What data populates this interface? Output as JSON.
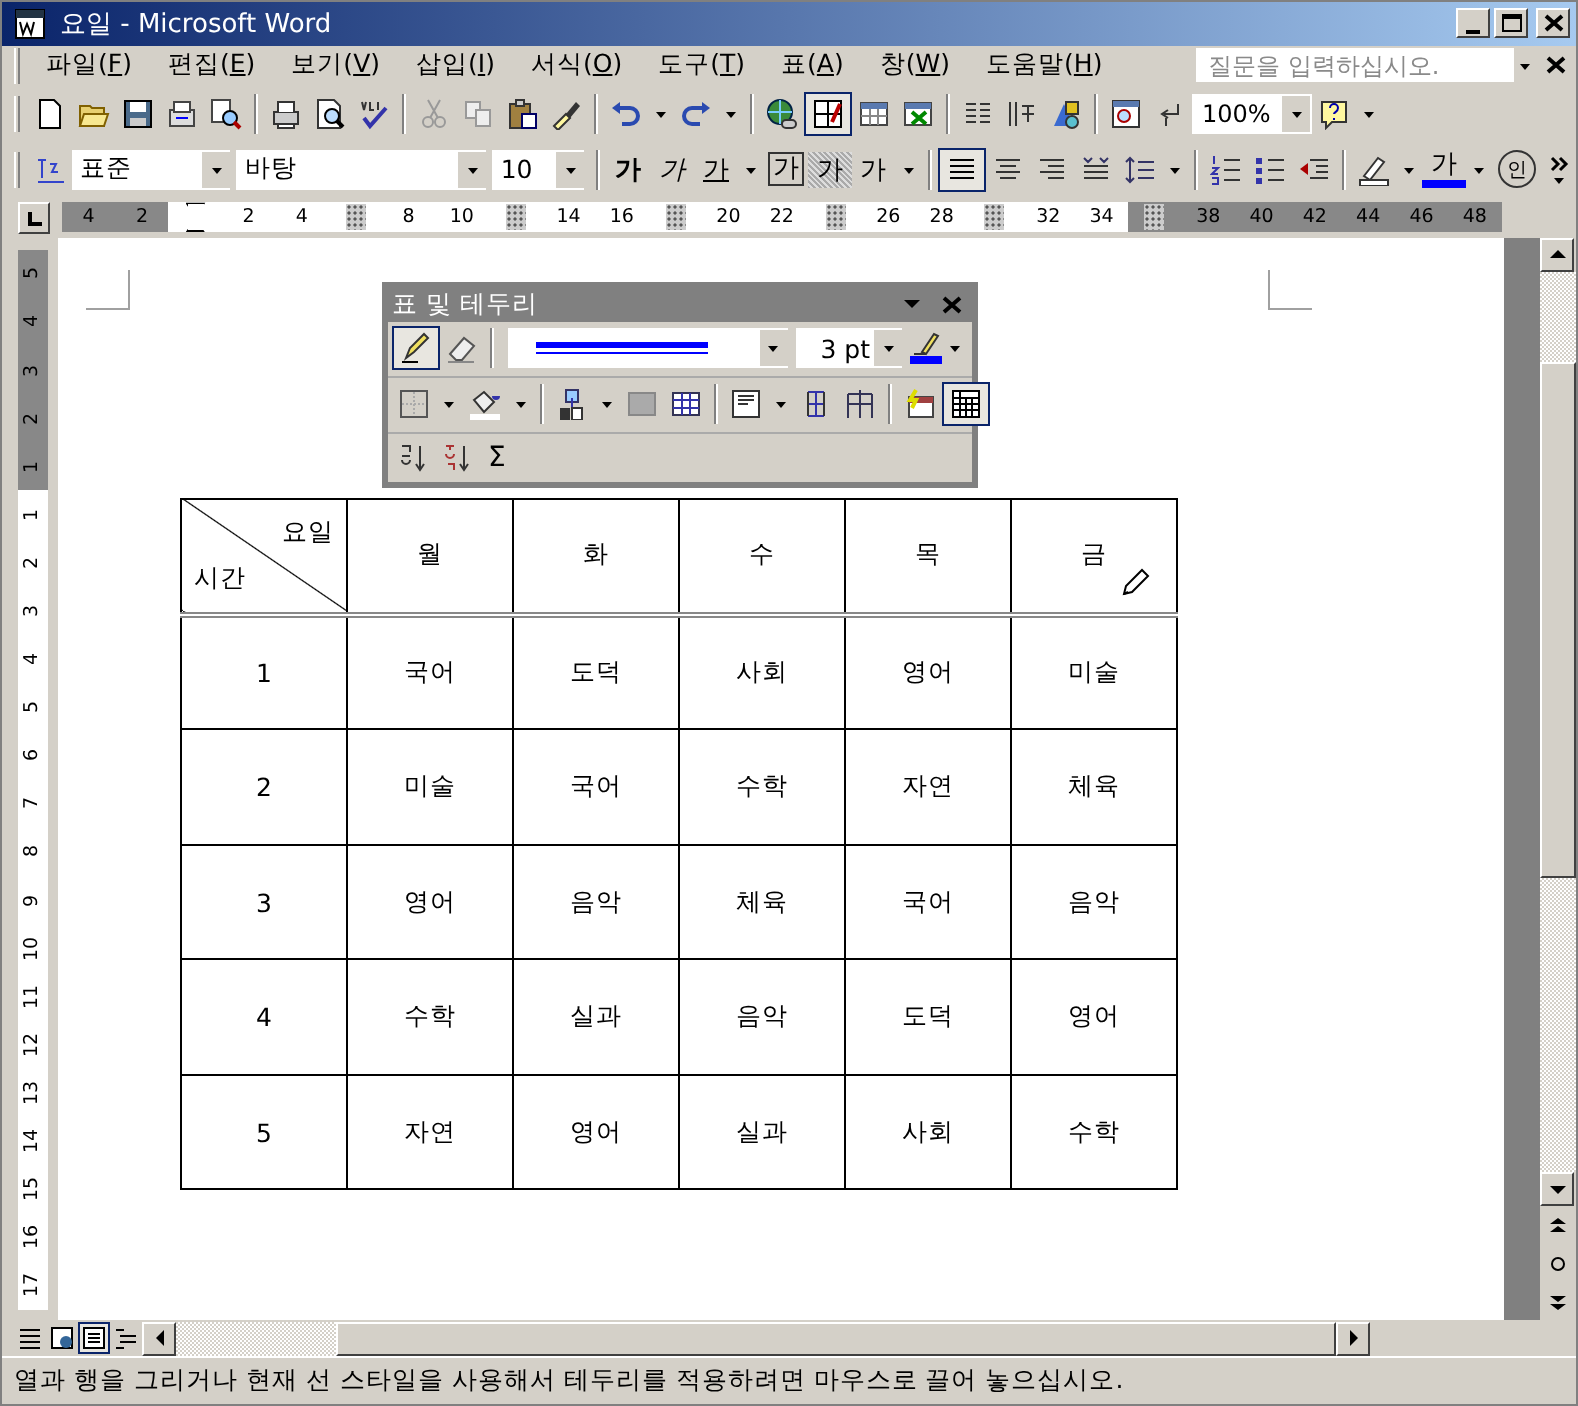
{
  "window": {
    "title": "요일 - Microsoft Word"
  },
  "menu_bar": {
    "items": [
      "파일(F)",
      "편집(E)",
      "보기(V)",
      "삽입(I)",
      "서식(O)",
      "도구(T)",
      "표(A)",
      "창(W)",
      "도움말(H)"
    ],
    "help_box": {
      "placeholder": "질문을 입력하십시오."
    }
  },
  "standard_toolbar": {
    "tables_and_borders_pressed": true,
    "zoom": "100%"
  },
  "formatting_toolbar": {
    "style": "표준",
    "font": "바탕",
    "size": "10",
    "glyph_buttons": [
      {
        "glyph": "가",
        "kind": "bold"
      },
      {
        "glyph": "가",
        "kind": "italic"
      },
      {
        "glyph": "가",
        "kind": "underline"
      },
      {
        "glyph": "가",
        "kind": "boxed"
      },
      {
        "glyph": "가",
        "kind": "shaded"
      },
      {
        "glyph": "가",
        "kind": "spacing"
      }
    ],
    "align_left_pressed": true,
    "font_color_glyph": "가",
    "enclosed_glyph": "인"
  },
  "ruler": [
    {
      "kind": "number",
      "label": "4",
      "shaded": true
    },
    {
      "kind": "number",
      "label": "2",
      "shaded": true
    },
    {
      "kind": "indent",
      "shaded": false
    },
    {
      "kind": "number",
      "label": "2",
      "shaded": false
    },
    {
      "kind": "number",
      "label": "4",
      "shaded": false
    },
    {
      "kind": "marker",
      "shaded": false
    },
    {
      "kind": "number",
      "label": "8",
      "shaded": false
    },
    {
      "kind": "number",
      "label": "10",
      "shaded": false
    },
    {
      "kind": "marker",
      "shaded": false
    },
    {
      "kind": "number",
      "label": "14",
      "shaded": false
    },
    {
      "kind": "number",
      "label": "16",
      "shaded": false
    },
    {
      "kind": "marker",
      "shaded": false
    },
    {
      "kind": "number",
      "label": "20",
      "shaded": false
    },
    {
      "kind": "number",
      "label": "22",
      "shaded": false
    },
    {
      "kind": "marker",
      "shaded": false
    },
    {
      "kind": "number",
      "label": "26",
      "shaded": false
    },
    {
      "kind": "number",
      "label": "28",
      "shaded": false
    },
    {
      "kind": "marker",
      "shaded": false
    },
    {
      "kind": "number",
      "label": "32",
      "shaded": false
    },
    {
      "kind": "number",
      "label": "34",
      "shaded": false
    },
    {
      "kind": "marker",
      "shaded": true
    },
    {
      "kind": "number",
      "label": "38",
      "shaded": true
    },
    {
      "kind": "number",
      "label": "40",
      "shaded": true
    },
    {
      "kind": "number",
      "label": "42",
      "shaded": true
    },
    {
      "kind": "number",
      "label": "44",
      "shaded": true
    },
    {
      "kind": "number",
      "label": "46",
      "shaded": true
    },
    {
      "kind": "number",
      "label": "48",
      "shaded": true
    }
  ],
  "vertical_ruler": [
    {
      "label": "5",
      "shaded": true
    },
    {
      "label": "4",
      "shaded": true
    },
    {
      "label": "3",
      "shaded": true
    },
    {
      "label": "2",
      "shaded": true
    },
    {
      "label": "1",
      "shaded": true
    },
    {
      "label": "1",
      "shaded": false
    },
    {
      "label": "2",
      "shaded": false
    },
    {
      "label": "3",
      "shaded": false
    },
    {
      "label": "4",
      "shaded": false
    },
    {
      "label": "5",
      "shaded": false
    },
    {
      "label": "6",
      "shaded": false
    },
    {
      "label": "7",
      "shaded": false
    },
    {
      "label": "8",
      "shaded": false
    },
    {
      "label": "9",
      "shaded": false
    },
    {
      "label": "10",
      "shaded": false
    },
    {
      "label": "11",
      "shaded": false
    },
    {
      "label": "12",
      "shaded": false
    },
    {
      "label": "13",
      "shaded": false
    },
    {
      "label": "14",
      "shaded": false
    },
    {
      "label": "15",
      "shaded": false
    },
    {
      "label": "16",
      "shaded": false
    },
    {
      "label": "17",
      "shaded": false
    }
  ],
  "tables_toolbar": {
    "title": "표 및 테두리",
    "pencil_pressed": true,
    "line_weight": "3 pt",
    "gridlines_pressed": true,
    "autosum_glyph": "Σ"
  },
  "table": {
    "corner": {
      "top": "요일",
      "bottom": "시간"
    },
    "columns": [
      "월",
      "화",
      "수",
      "목",
      "금"
    ],
    "rows": [
      {
        "period": "1",
        "cells": [
          "국어",
          "도덕",
          "사회",
          "영어",
          "미술"
        ]
      },
      {
        "period": "2",
        "cells": [
          "미술",
          "국어",
          "수학",
          "자연",
          "체육"
        ]
      },
      {
        "period": "3",
        "cells": [
          "영어",
          "음악",
          "체육",
          "국어",
          "음악"
        ]
      },
      {
        "period": "4",
        "cells": [
          "수학",
          "실과",
          "음악",
          "도덕",
          "영어"
        ]
      },
      {
        "period": "5",
        "cells": [
          "자연",
          "영어",
          "실과",
          "사회",
          "수학"
        ]
      }
    ]
  },
  "view_buttons": [
    {
      "kind": "normal",
      "selected": false
    },
    {
      "kind": "web",
      "selected": false
    },
    {
      "kind": "print",
      "selected": true
    },
    {
      "kind": "outline",
      "selected": false
    }
  ],
  "status_bar": "열과 행을 그리거나 현재 선 스타일을 사용해서 테두리를 적용하려면 마우스로 끌어 놓으십시오."
}
